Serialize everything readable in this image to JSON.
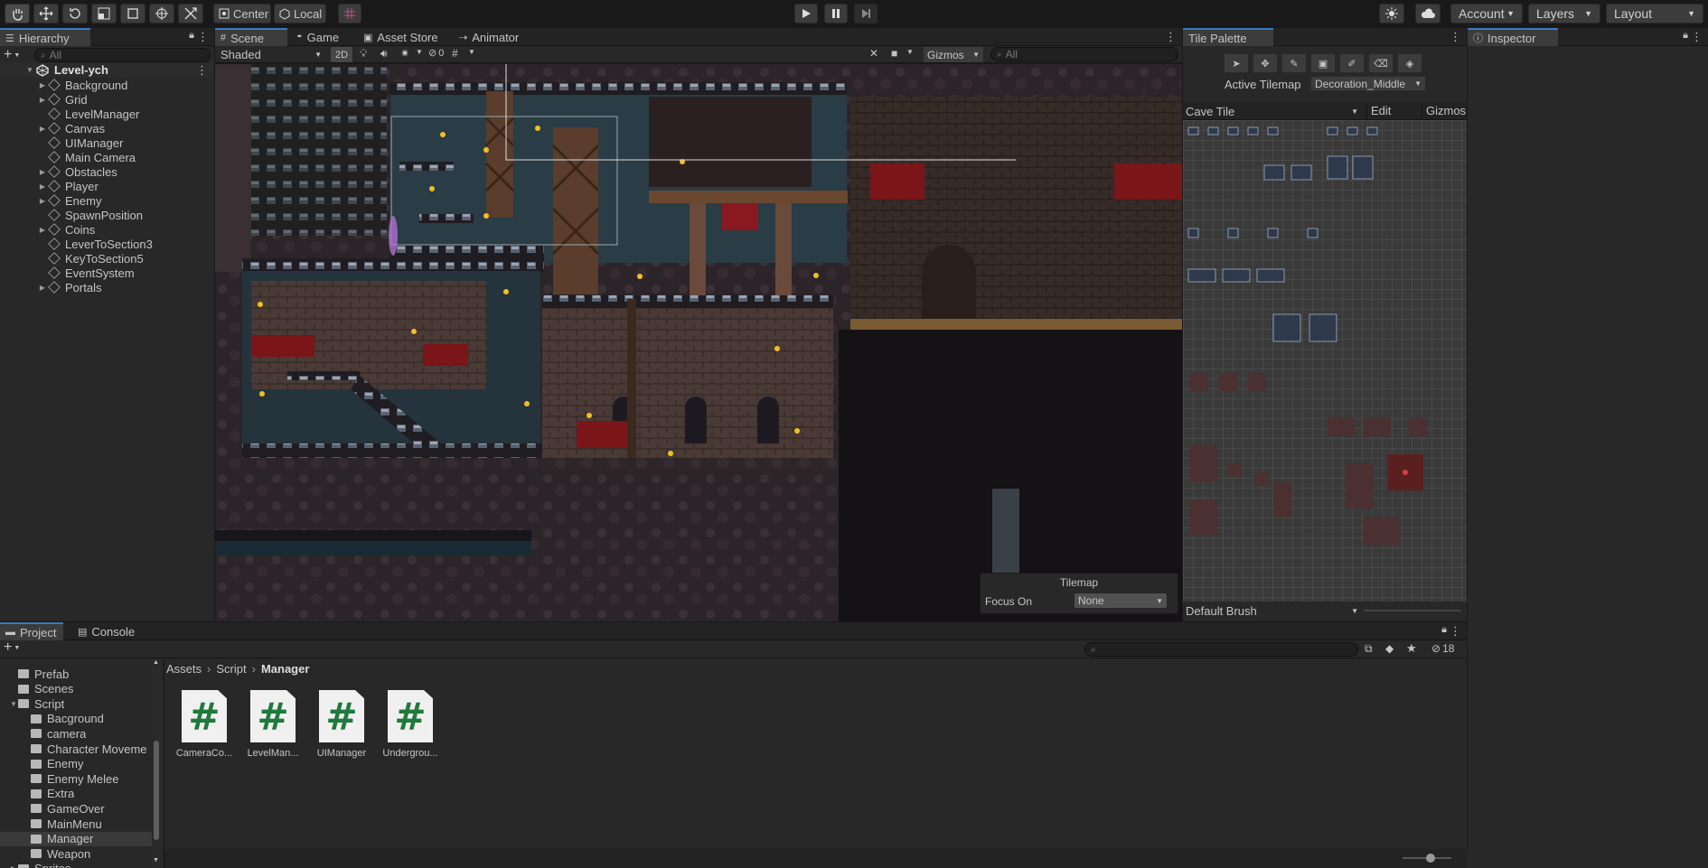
{
  "toolbar": {
    "pivot_label": "Center",
    "space_label": "Local",
    "account_label": "Account",
    "layers_label": "Layers",
    "layout_label": "Layout"
  },
  "hierarchy": {
    "tab_label": "Hierarchy",
    "search_placeholder": "All",
    "scene_name": "Level-ych",
    "items": [
      {
        "label": "Background",
        "expandable": true
      },
      {
        "label": "Grid",
        "expandable": true
      },
      {
        "label": "LevelManager",
        "expandable": false
      },
      {
        "label": "Canvas",
        "expandable": true
      },
      {
        "label": "UIManager",
        "expandable": false
      },
      {
        "label": "Main Camera",
        "expandable": false
      },
      {
        "label": "Obstacles",
        "expandable": true
      },
      {
        "label": "Player",
        "expandable": true
      },
      {
        "label": "Enemy",
        "expandable": true
      },
      {
        "label": "SpawnPosition",
        "expandable": false
      },
      {
        "label": "Coins",
        "expandable": true
      },
      {
        "label": "LeverToSection3",
        "expandable": false
      },
      {
        "label": "KeyToSection5",
        "expandable": false
      },
      {
        "label": "EventSystem",
        "expandable": false
      },
      {
        "label": "Portals",
        "expandable": true
      }
    ]
  },
  "scene": {
    "tabs": [
      "Scene",
      "Game",
      "Asset Store",
      "Animator"
    ],
    "shading_mode": "Shaded",
    "mode_2d_label": "2D",
    "hidden_count": "0",
    "gizmos_label": "Gizmos",
    "search_placeholder": "All",
    "overlay_title": "Tilemap",
    "focus_label": "Focus On",
    "focus_value": "None"
  },
  "tile_palette": {
    "tab_label": "Tile Palette",
    "active_tilemap_label": "Active Tilemap",
    "active_tilemap_value": "Decoration_Middle",
    "palette_name": "Cave Tile",
    "edit_label": "Edit",
    "gizmos_label": "Gizmos",
    "brush_label": "Default Brush"
  },
  "inspector": {
    "tab_label": "Inspector"
  },
  "project": {
    "tabs": [
      "Project",
      "Console"
    ],
    "hidden_count": "18",
    "breadcrumb": [
      "Assets",
      "Script",
      "Manager"
    ],
    "tree": [
      {
        "label": "Prefab",
        "indent": 1,
        "expanded": false,
        "selected": false
      },
      {
        "label": "Scenes",
        "indent": 1,
        "expanded": false,
        "selected": false
      },
      {
        "label": "Script",
        "indent": 1,
        "expanded": true,
        "selected": false
      },
      {
        "label": "Bacground",
        "indent": 2,
        "expanded": false,
        "selected": false
      },
      {
        "label": "camera",
        "indent": 2,
        "expanded": false,
        "selected": false
      },
      {
        "label": "Character Moveme",
        "indent": 2,
        "expanded": false,
        "selected": false
      },
      {
        "label": "Enemy",
        "indent": 2,
        "expanded": false,
        "selected": false
      },
      {
        "label": "Enemy Melee",
        "indent": 2,
        "expanded": false,
        "selected": false
      },
      {
        "label": "Extra",
        "indent": 2,
        "expanded": false,
        "selected": false
      },
      {
        "label": "GameOver",
        "indent": 2,
        "expanded": false,
        "selected": false
      },
      {
        "label": "MainMenu",
        "indent": 2,
        "expanded": false,
        "selected": false
      },
      {
        "label": "Manager",
        "indent": 2,
        "expanded": false,
        "selected": true
      },
      {
        "label": "Weapon",
        "indent": 2,
        "expanded": false,
        "selected": false
      },
      {
        "label": "Sprites",
        "indent": 1,
        "expanded": false,
        "selected": false
      }
    ],
    "assets": [
      {
        "label": "CameraCo..."
      },
      {
        "label": "LevelMan..."
      },
      {
        "label": "UIManager"
      },
      {
        "label": "Undergrou..."
      }
    ]
  },
  "colors": {
    "accent": "#3a79bb",
    "script_icon": "#1f7a3b",
    "bg": "#282828"
  }
}
